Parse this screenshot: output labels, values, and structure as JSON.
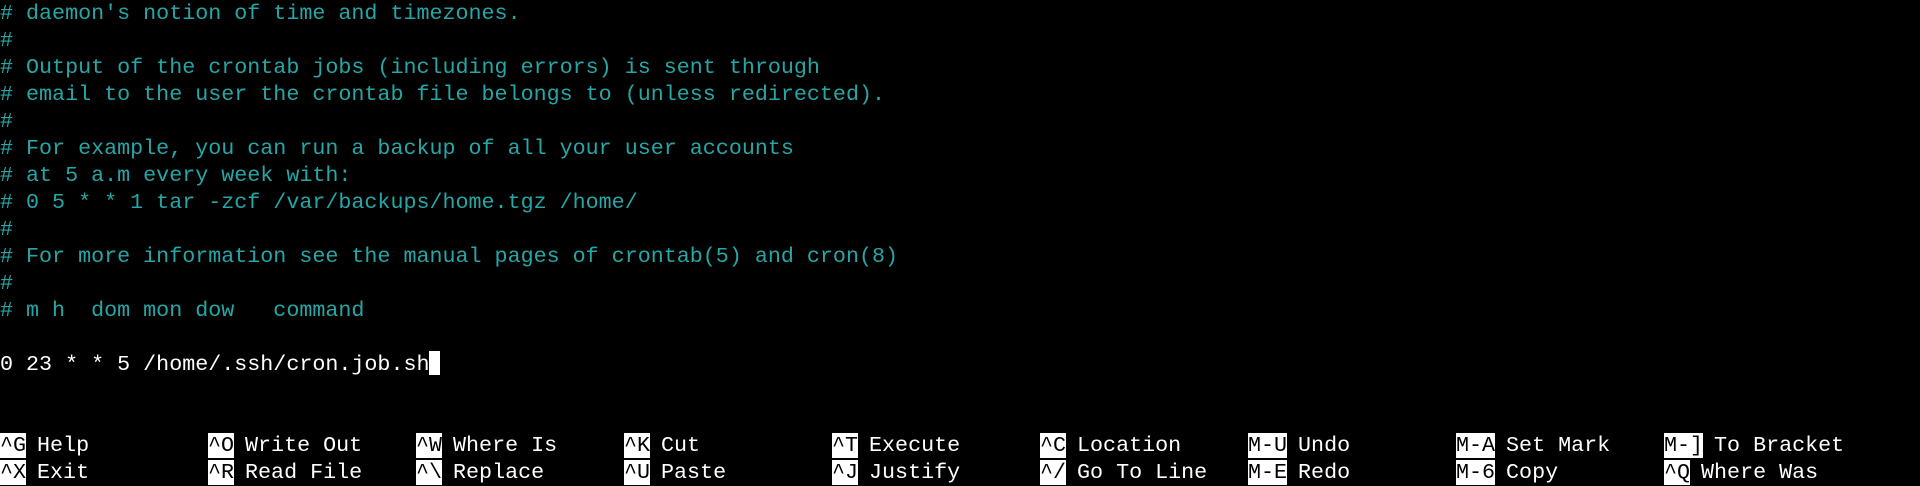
{
  "editor": {
    "lines": [
      {
        "text": "# daemon's notion of time and timezones.",
        "kind": "comment"
      },
      {
        "text": "#",
        "kind": "comment"
      },
      {
        "text": "# Output of the crontab jobs (including errors) is sent through",
        "kind": "comment"
      },
      {
        "text": "# email to the user the crontab file belongs to (unless redirected).",
        "kind": "comment"
      },
      {
        "text": "#",
        "kind": "comment"
      },
      {
        "text": "# For example, you can run a backup of all your user accounts",
        "kind": "comment"
      },
      {
        "text": "# at 5 a.m every week with:",
        "kind": "comment"
      },
      {
        "text": "# 0 5 * * 1 tar -zcf /var/backups/home.tgz /home/",
        "kind": "comment"
      },
      {
        "text": "#",
        "kind": "comment"
      },
      {
        "text": "# For more information see the manual pages of crontab(5) and cron(8)",
        "kind": "comment"
      },
      {
        "text": "#",
        "kind": "comment"
      },
      {
        "text": "# m h  dom mon dow   command",
        "kind": "comment"
      },
      {
        "text": "",
        "kind": "plain"
      },
      {
        "text": "0 23 * * 5 /home/.ssh/cron.job.sh",
        "kind": "plain"
      }
    ],
    "comment_color": "#26a6a6",
    "text_color": "#ffffff",
    "background": "#000000"
  },
  "shortcuts": {
    "row1": [
      {
        "key": "^G",
        "label": "Help"
      },
      {
        "key": "^O",
        "label": "Write Out"
      },
      {
        "key": "^W",
        "label": "Where Is"
      },
      {
        "key": "^K",
        "label": "Cut"
      },
      {
        "key": "^T",
        "label": "Execute"
      },
      {
        "key": "^C",
        "label": "Location"
      },
      {
        "key": "M-U",
        "label": "Undo"
      },
      {
        "key": "M-A",
        "label": "Set Mark"
      },
      {
        "key": "M-]",
        "label": "To Bracket"
      }
    ],
    "row2": [
      {
        "key": "^X",
        "label": "Exit"
      },
      {
        "key": "^R",
        "label": "Read File"
      },
      {
        "key": "^\\",
        "label": "Replace"
      },
      {
        "key": "^U",
        "label": "Paste"
      },
      {
        "key": "^J",
        "label": "Justify"
      },
      {
        "key": "^/",
        "label": "Go To Line"
      },
      {
        "key": "M-E",
        "label": "Redo"
      },
      {
        "key": "M-6",
        "label": "Copy"
      },
      {
        "key": "^Q",
        "label": "Where Was"
      }
    ]
  }
}
